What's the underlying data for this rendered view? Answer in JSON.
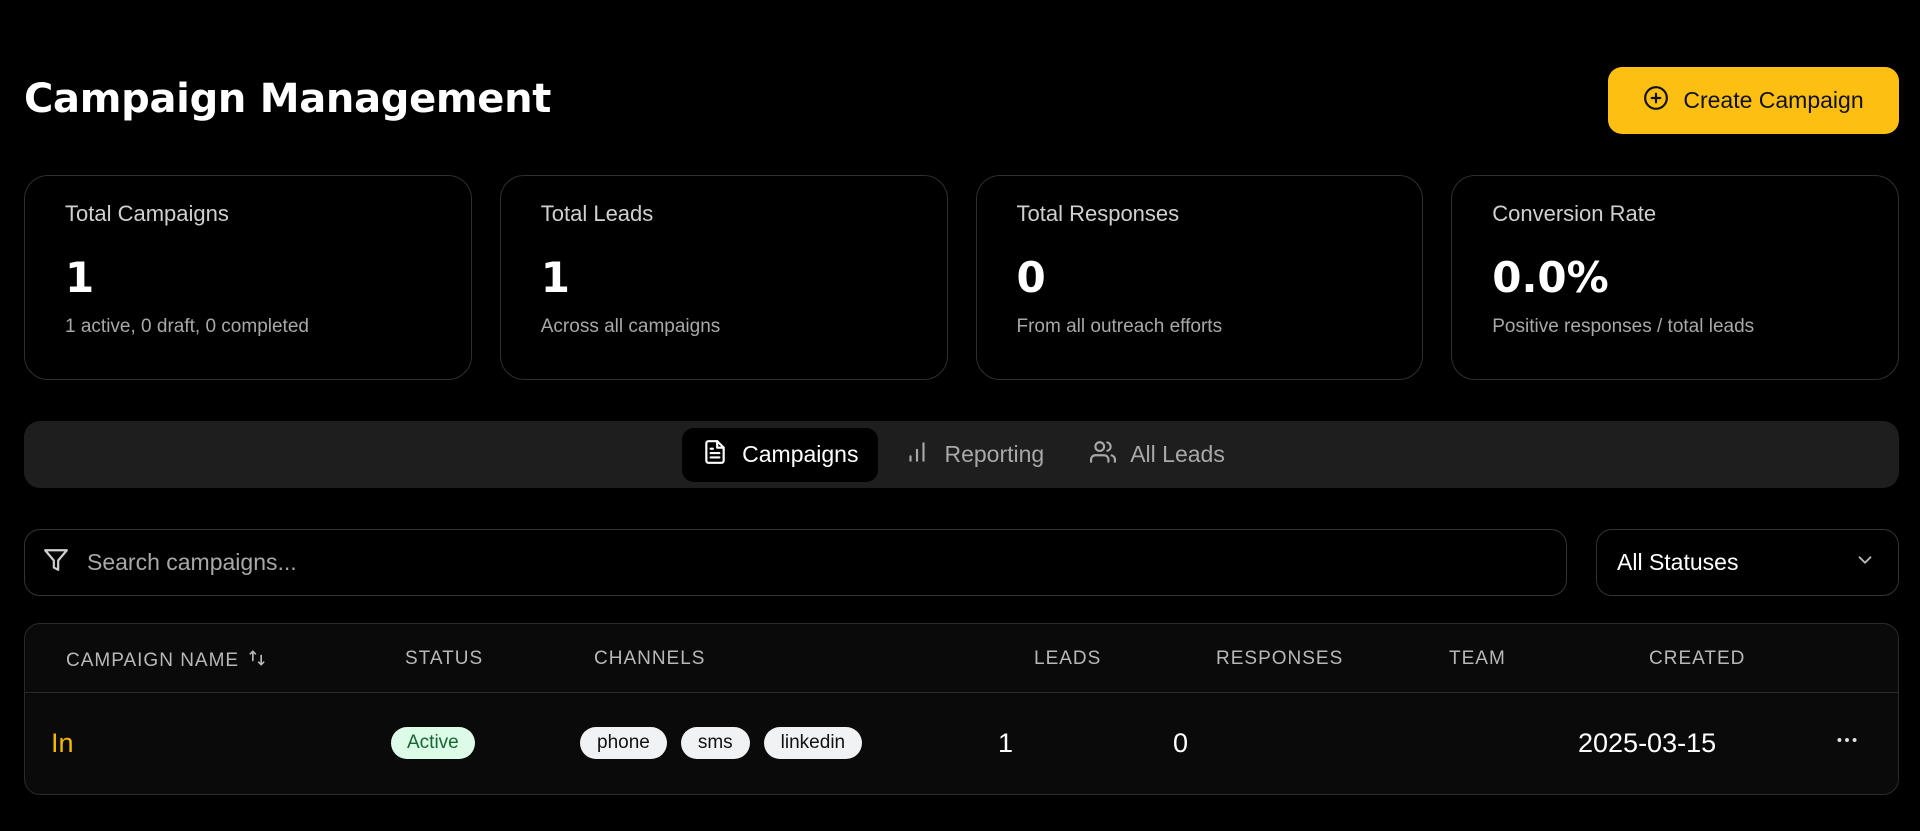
{
  "header": {
    "title": "Campaign Management",
    "create_button_label": "Create Campaign"
  },
  "stats": [
    {
      "label": "Total Campaigns",
      "value": "1",
      "subtext": "1 active, 0 draft, 0 completed"
    },
    {
      "label": "Total Leads",
      "value": "1",
      "subtext": "Across all campaigns"
    },
    {
      "label": "Total Responses",
      "value": "0",
      "subtext": "From all outreach efforts"
    },
    {
      "label": "Conversion Rate",
      "value": "0.0%",
      "subtext": "Positive responses / total leads"
    }
  ],
  "tabs": [
    {
      "label": "Campaigns",
      "icon": "file-text-icon",
      "active": true
    },
    {
      "label": "Reporting",
      "icon": "bar-chart-icon",
      "active": false
    },
    {
      "label": "All Leads",
      "icon": "users-icon",
      "active": false
    }
  ],
  "filters": {
    "search_placeholder": "Search campaigns...",
    "search_value": "",
    "status_selected": "All Statuses"
  },
  "table": {
    "columns": [
      "CAMPAIGN NAME",
      "STATUS",
      "CHANNELS",
      "LEADS",
      "RESPONSES",
      "TEAM",
      "CREATED"
    ],
    "rows": [
      {
        "name": "In",
        "status": "Active",
        "channels": [
          "phone",
          "sms",
          "linkedin"
        ],
        "leads": "1",
        "responses": "0",
        "team": "",
        "created": "2025-03-15"
      }
    ]
  },
  "colors": {
    "accent": "#fcbf12",
    "background": "#000000",
    "status_active_bg": "#dcfce7",
    "status_active_text": "#166534"
  }
}
